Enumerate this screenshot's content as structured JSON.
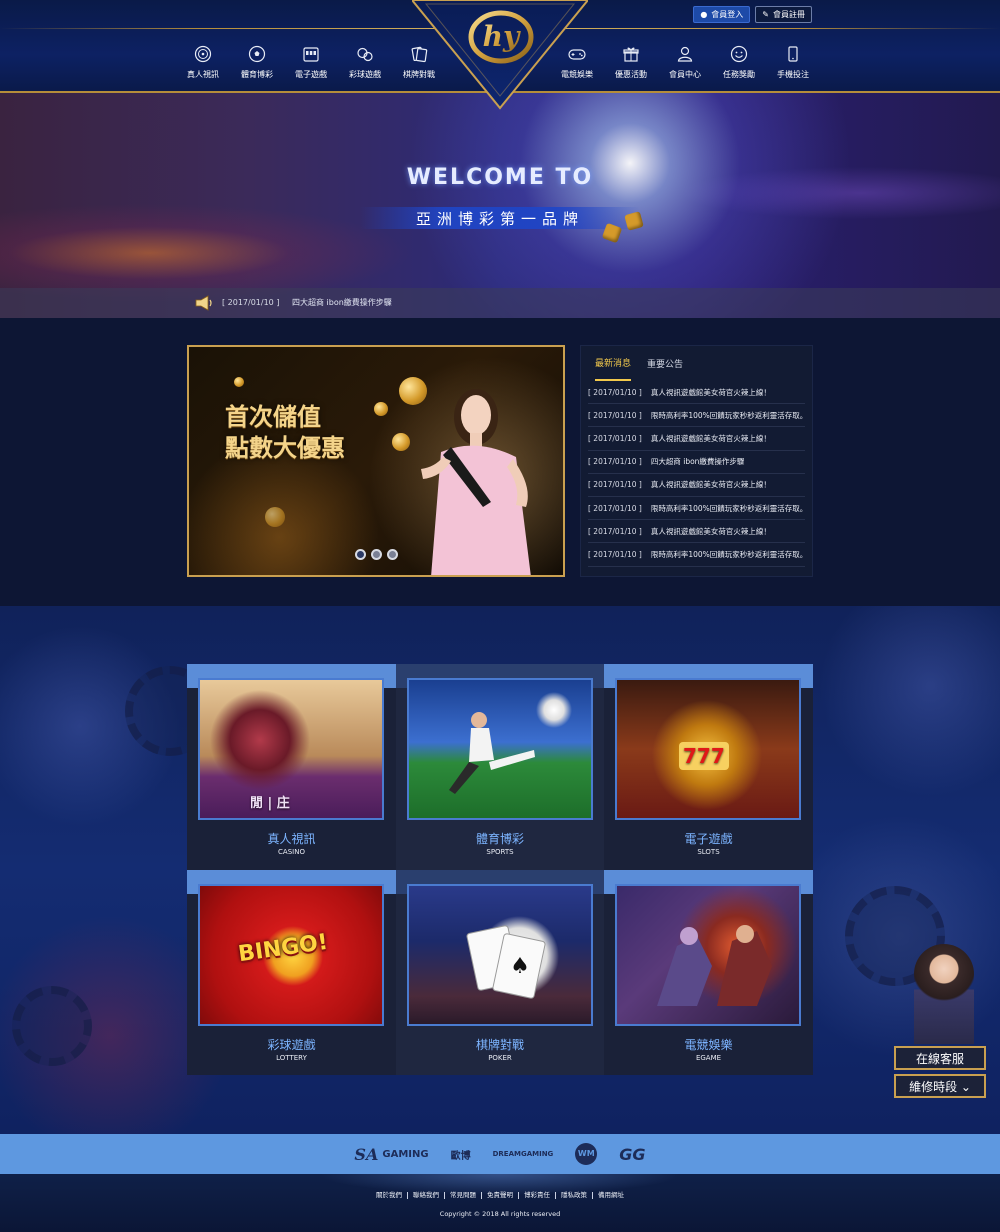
{
  "header": {
    "login_label": "會員登入",
    "register_label": "會員註冊",
    "logo_text": "hy",
    "nav_left": [
      {
        "label": "真人視訊",
        "icon": "roulette-icon"
      },
      {
        "label": "體育博彩",
        "icon": "soccer-ball-icon"
      },
      {
        "label": "電子遊戲",
        "icon": "slot-machine-icon"
      },
      {
        "label": "彩球遊戲",
        "icon": "lottery-balls-icon"
      },
      {
        "label": "棋牌對戰",
        "icon": "cards-icon"
      }
    ],
    "nav_right": [
      {
        "label": "電競娛樂",
        "icon": "gamepad-icon"
      },
      {
        "label": "優惠活動",
        "icon": "gift-icon"
      },
      {
        "label": "會員中心",
        "icon": "user-icon"
      },
      {
        "label": "任務獎勵",
        "icon": "smiley-icon"
      },
      {
        "label": "手機投注",
        "icon": "mobile-icon"
      }
    ]
  },
  "banner": {
    "welcome": "WELCOME TO",
    "subtitle": "亞洲博彩第一品牌"
  },
  "ticker": {
    "date": "[ 2017/01/10 ]",
    "text": "四大超商 ibon繳費操作步驟"
  },
  "promo_slider": {
    "title_line1": "首次儲值",
    "title_line2": "點數大優惠",
    "slides": 3,
    "active_slide": 1
  },
  "news": {
    "tabs": [
      "最新消息",
      "重要公告"
    ],
    "active_tab": 0,
    "items": [
      {
        "date": "[ 2017/01/10 ]",
        "text": "真人視訊遊戲館美女荷官火辣上線！"
      },
      {
        "date": "[ 2017/01/10 ]",
        "text": "限時高利率100%回饋玩家秒秒返利靈活存取。"
      },
      {
        "date": "[ 2017/01/10 ]",
        "text": "真人視訊遊戲館美女荷官火辣上線！"
      },
      {
        "date": "[ 2017/01/10 ]",
        "text": "四大超商 ibon繳費操作步驟"
      },
      {
        "date": "[ 2017/01/10 ]",
        "text": "真人視訊遊戲館美女荷官火辣上線！"
      },
      {
        "date": "[ 2017/01/10 ]",
        "text": "限時高利率100%回饋玩家秒秒返利靈活存取。"
      },
      {
        "date": "[ 2017/01/10 ]",
        "text": "真人視訊遊戲館美女荷官火辣上線！"
      },
      {
        "date": "[ 2017/01/10 ]",
        "text": "限時高利率100%回饋玩家秒秒返利靈活存取。"
      }
    ]
  },
  "games": [
    {
      "title": "真人視訊",
      "sub": "CASINO",
      "img_text": "閒 | 庄"
    },
    {
      "title": "體育博彩",
      "sub": "SPORTS",
      "img_text": ""
    },
    {
      "title": "電子遊戲",
      "sub": "SLOTS",
      "img_text": "777"
    },
    {
      "title": "彩球遊戲",
      "sub": "LOTTERY",
      "img_text": "BINGO!"
    },
    {
      "title": "棋牌對戰",
      "sub": "POKER",
      "img_text": ""
    },
    {
      "title": "電競娛樂",
      "sub": "EGAME",
      "img_text": ""
    }
  ],
  "side_widget": {
    "service_label": "在線客服",
    "maintenance_label": "維修時段 ⌄"
  },
  "partners": [
    "GAMING",
    "歐博",
    "DREAMGAMING",
    "WM",
    "GG"
  ],
  "footer": {
    "links": [
      "關於我們",
      "聯絡我們",
      "常見問題",
      "免責聲明",
      "博彩責任",
      "隱私政策",
      "備用網址"
    ],
    "copyright": "Copyright © 2018 All rights reserved"
  },
  "colors": {
    "accent_gold": "#c9a050",
    "news_active": "#f2c94c",
    "card_title": "#7cb4ff",
    "partner_bar": "#5e98e0"
  }
}
